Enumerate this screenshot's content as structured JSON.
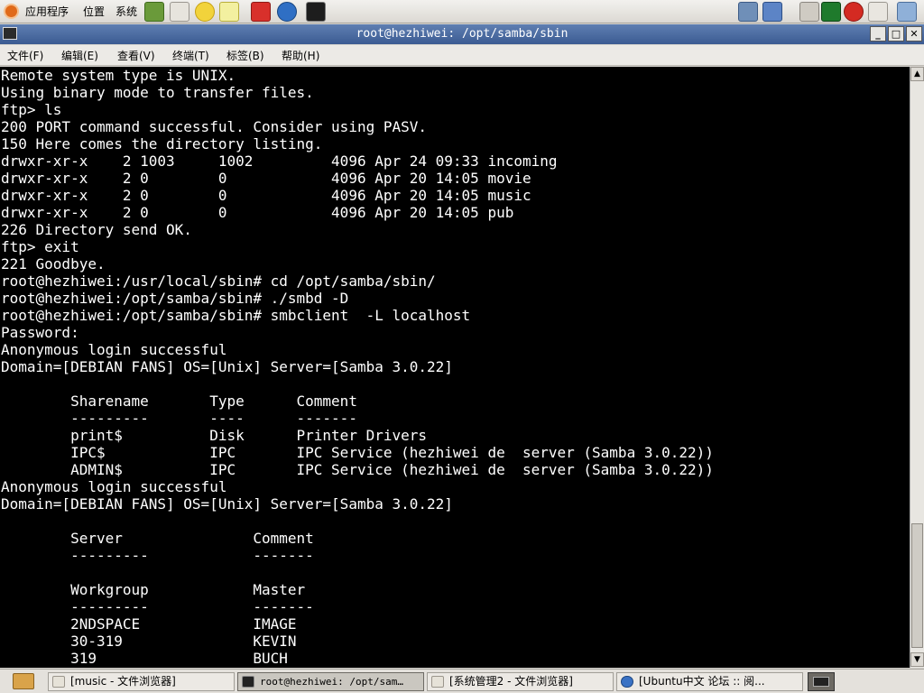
{
  "top_panel": {
    "menus": [
      "应用程序",
      "位置",
      "系统"
    ]
  },
  "window": {
    "title": "root@hezhiwei: /opt/samba/sbin",
    "menu": [
      "文件(F)",
      "编辑(E)",
      "查看(V)",
      "终端(T)",
      "标签(B)",
      "帮助(H)"
    ]
  },
  "terminal": {
    "lines": [
      "Remote system type is UNIX.",
      "Using binary mode to transfer files.",
      "ftp> ls",
      "200 PORT command successful. Consider using PASV.",
      "150 Here comes the directory listing.",
      "drwxr-xr-x    2 1003     1002         4096 Apr 24 09:33 incoming",
      "drwxr-xr-x    2 0        0            4096 Apr 20 14:05 movie",
      "drwxr-xr-x    2 0        0            4096 Apr 20 14:05 music",
      "drwxr-xr-x    2 0        0            4096 Apr 20 14:05 pub",
      "226 Directory send OK.",
      "ftp> exit",
      "221 Goodbye.",
      "root@hezhiwei:/usr/local/sbin# cd /opt/samba/sbin/",
      "root@hezhiwei:/opt/samba/sbin# ./smbd -D",
      "root@hezhiwei:/opt/samba/sbin# smbclient  -L localhost",
      "Password:",
      "Anonymous login successful",
      "Domain=[DEBIAN FANS] OS=[Unix] Server=[Samba 3.0.22]",
      "",
      "        Sharename       Type      Comment",
      "        ---------       ----      -------",
      "        print$          Disk      Printer Drivers",
      "        IPC$            IPC       IPC Service (hezhiwei de  server (Samba 3.0.22))",
      "        ADMIN$          IPC       IPC Service (hezhiwei de  server (Samba 3.0.22))",
      "Anonymous login successful",
      "Domain=[DEBIAN FANS] OS=[Unix] Server=[Samba 3.0.22]",
      "",
      "        Server               Comment",
      "        ---------            -------",
      "",
      "        Workgroup            Master",
      "        ---------            -------",
      "        2NDSPACE             IMAGE",
      "        30-319               KEVIN",
      "        319                  BUCH"
    ]
  },
  "taskbar": {
    "tasks": [
      {
        "label": "[music - 文件浏览器]"
      },
      {
        "label": "root@hezhiwei: /opt/sam…"
      },
      {
        "label": "[系统管理2 - 文件浏览器]"
      },
      {
        "label": "[Ubuntu中文 论坛 :: 阅..."
      }
    ]
  },
  "colors": {
    "terminal_bg": "#000000",
    "terminal_fg": "#ffffff",
    "titlebar": "#4a6aa0"
  }
}
